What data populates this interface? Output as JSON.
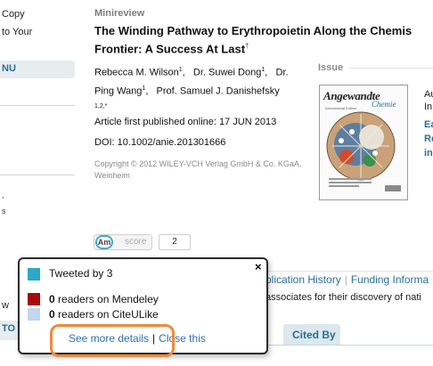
{
  "left_sidebar": {
    "top_links": [
      "Copy",
      "to Your"
    ],
    "menu_label": "NU",
    "bottom_items": [
      "w",
      "TO"
    ]
  },
  "article": {
    "section": "Minireview",
    "title_line1": "The Winding Pathway to Erythropoietin Along the Chemis",
    "title_line2": "Frontier: A Success At Last",
    "title_footnote": "†",
    "authors": [
      {
        "name": "Rebecca M. Wilson",
        "aff": "1"
      },
      {
        "name": "Dr. Suwei Dong",
        "aff": "1"
      },
      {
        "name": "Dr. Ping Wang",
        "aff": "1"
      },
      {
        "name": "Prof. Samuel J. Danishefsky",
        "aff": "1,2,*"
      }
    ],
    "published": "Article first published online: 17 JUN 2013",
    "doi": "DOI: 10.1002/anie.201301666",
    "copyright": "Copyright © 2012 WILEY-VCH Verlag GmbH & Co. KGaA, Weinheim"
  },
  "issue": {
    "label": "Issue",
    "cover_journal": "Angewandte",
    "cover_subtitle": "Chemie",
    "cover_edition": "International Edition",
    "side_fragments": [
      "Au",
      "In",
      "Ea",
      "Re",
      "in"
    ]
  },
  "altmetric": {
    "badge_text": "Am",
    "score_label": "score",
    "count": "2"
  },
  "tabs": {
    "links": [
      "blication History",
      "Funding Informa"
    ],
    "snippet": "associates for their discovery of nati",
    "cited_by": "Cited By"
  },
  "popup": {
    "close": "×",
    "tweeted": "Tweeted by 3",
    "mendeley_count": "0",
    "mendeley_text": "readers on Mendeley",
    "citeulike_count": "0",
    "citeulike_text": "readers on CiteULike",
    "see_more": "See more details",
    "close_this": "Close this"
  },
  "colors": {
    "twitter": "#2ea7c9",
    "mendeley": "#a80a0a",
    "citeulike": "#c4d6ee",
    "highlight": "#ee8a3a",
    "link": "#2a6f96"
  }
}
